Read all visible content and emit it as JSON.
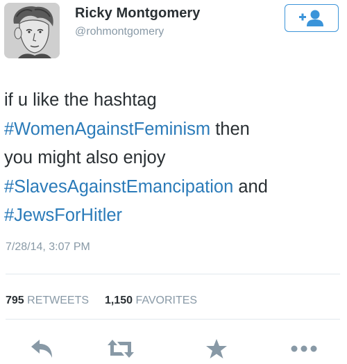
{
  "user": {
    "name": "Ricky Montgomery",
    "handle": "@rohmontgomery"
  },
  "follow_button": {
    "icon": "add-user-icon",
    "symbol": "+"
  },
  "tweet": {
    "line1": "if u like the hashtag",
    "line2_tag": "#WomenAgainstFeminism",
    "line2_rest": " then",
    "line3": "you might also enjoy",
    "line4_tag": "#SlavesAgainstEmancipation",
    "line4_rest": " and",
    "line5_tag": "#JewsForHitler",
    "timestamp": "7/28/14, 3:07 PM"
  },
  "stats": {
    "retweets_count": "795",
    "retweets_label": "RETWEETS",
    "favorites_count": "1,150",
    "favorites_label": "FAVORITES"
  },
  "actions": {
    "reply": "reply-icon",
    "retweet": "retweet-icon",
    "favorite": "star-icon",
    "more": "more-icon"
  },
  "colors": {
    "hashtag": "#2b7bb9",
    "secondary_text": "#8899a6",
    "primary_text": "#292f33",
    "icon_gray": "#8899a6",
    "button_blue": "#3b94d9"
  }
}
